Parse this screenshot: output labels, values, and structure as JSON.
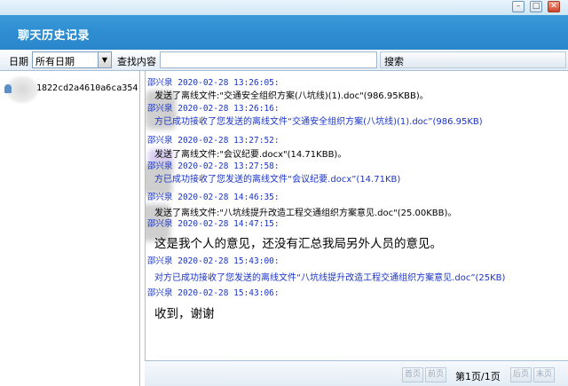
{
  "window": {
    "title": "聊天历史记录",
    "controls": [
      "minimize-icon",
      "maximize-icon",
      "close-icon"
    ]
  },
  "toolbar": {
    "date_label": "日期",
    "date_value": "所有日期",
    "search_content_label": "查找内容",
    "search_button": "搜索"
  },
  "sidebar": {
    "contact_id": "1822cd2a4610a6ca354"
  },
  "messages": [
    {
      "header": "邵兴泉 2020-02-28 13:26:05:",
      "body": "发送了离线文件:\"交通安全组织方案(八坑线)(1).doc\"(986.95KBB)。"
    },
    {
      "header": "邵兴泉 2020-02-28 13:26:16:",
      "body": "方已成功接收了您发送的离线文件“交通安全组织方案(八坑线)(1).doc”(986.95KB)"
    },
    {
      "header": "邵兴泉 2020-02-28 13:27:52:",
      "body": "发送了离线文件:\"会议纪要.docx\"(14.71KBB)。"
    },
    {
      "header": "邵兴泉 2020-02-28 13:27:58:",
      "body": "方已成功接收了您发送的离线文件“会议纪要.docx”(14.71KB)"
    },
    {
      "header": "邵兴泉 2020-02-28 14:46:35:",
      "body": "发送了离线文件:\"八坑线提升改造工程交通组织方案意见.doc\"(25.00KBB)。"
    },
    {
      "header": "邵兴泉 2020-02-28 14:47:15:",
      "body": "这是我个人的意见，还没有汇总我局另外人员的意见。"
    },
    {
      "header": "邵兴泉 2020-02-28 15:43:00:",
      "body": "对方已成功接收了您发送的离线文件“八坑线提升改造工程交通组织方案意见.doc”(25KB)"
    },
    {
      "header": "邵兴泉 2020-02-28 15:43:06:",
      "body": "收到，谢谢"
    }
  ],
  "pager": {
    "first": "首页",
    "prev": "前页",
    "info": "第1页/1页",
    "next": "后页",
    "last": "末页"
  }
}
